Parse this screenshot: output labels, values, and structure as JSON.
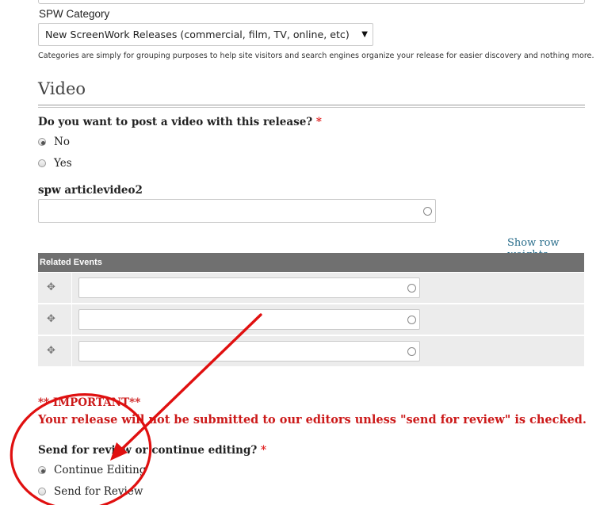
{
  "category": {
    "label": "SPW Category",
    "selected": "New ScreenWork Releases (commercial, film, TV, online, etc)",
    "help": "Categories are simply for grouping purposes to help site visitors and search engines organize your release for easier discovery and nothing more."
  },
  "video_section": {
    "title": "Video",
    "question": "Do you want to post a video with this release?",
    "required_mark": "*",
    "options": [
      "No",
      "Yes"
    ],
    "selected": "No"
  },
  "articlevideo": {
    "label": "spw articlevideo2",
    "value": ""
  },
  "related_events": {
    "show_weights": "Show row weights",
    "header": "Related Events",
    "rows": [
      "",
      "",
      ""
    ]
  },
  "important": {
    "title": "** IMPORTANT**",
    "message": "Your release will not be submitted to our editors unless \"send for review\" is checked."
  },
  "review": {
    "question": "Send for review or continue editing?",
    "required_mark": "*",
    "options": [
      "Continue Editing",
      "Send for Review"
    ],
    "selected": "Continue Editing"
  },
  "colors": {
    "accent_red": "#e01010",
    "table_header": "#707070",
    "link": "#2a6e8c"
  },
  "icons": {
    "drag_handle": "move-arrows-icon",
    "select_arrow": "triangle-down-icon",
    "autocomplete": "circle-icon"
  }
}
